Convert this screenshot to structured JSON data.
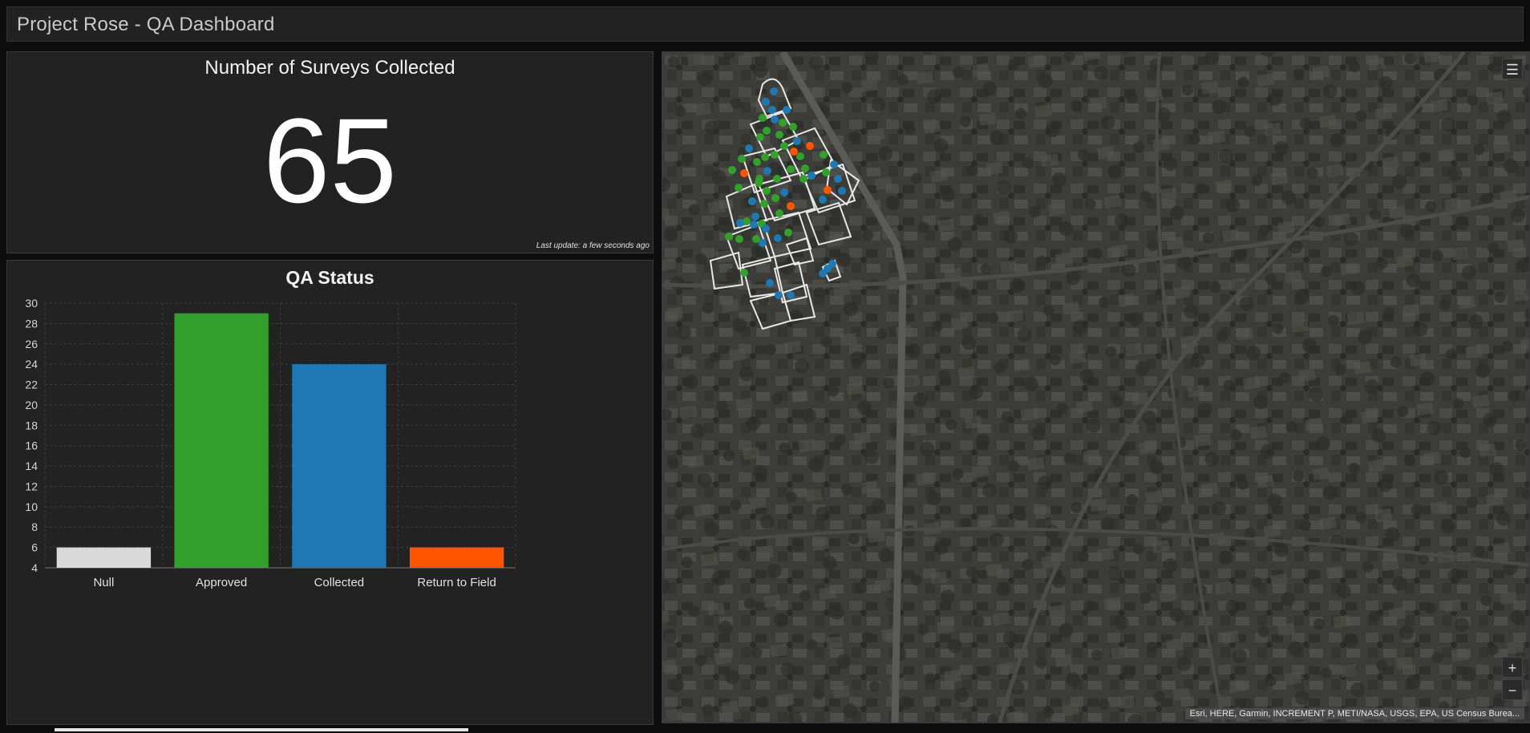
{
  "app": {
    "title": "Project Rose - QA Dashboard"
  },
  "indicator": {
    "title": "Number of Surveys Collected",
    "value": "65",
    "last_update": "Last update: a few seconds ago"
  },
  "chart": {
    "title": "QA Status"
  },
  "chart_data": {
    "type": "bar",
    "title": "QA Status",
    "categories": [
      "Null",
      "Approved",
      "Collected",
      "Return to Field"
    ],
    "values": [
      6,
      29,
      24,
      6
    ],
    "colors": [
      "#d9d9d9",
      "#33a02c",
      "#1f78b4",
      "#ff5500"
    ],
    "ylim": [
      4,
      30
    ],
    "yticks": [
      4,
      6,
      8,
      10,
      12,
      14,
      16,
      18,
      20,
      22,
      24,
      26,
      28,
      30
    ],
    "grid": true,
    "xlabel": "",
    "ylabel": ""
  },
  "map": {
    "legend_icon": "list-icon",
    "zoom_in_label": "+",
    "zoom_out_label": "−",
    "attribution": "Esri, HERE, Garmin, INCREMENT P, METI/NASA, USGS, EPA, US Census Burea..."
  }
}
